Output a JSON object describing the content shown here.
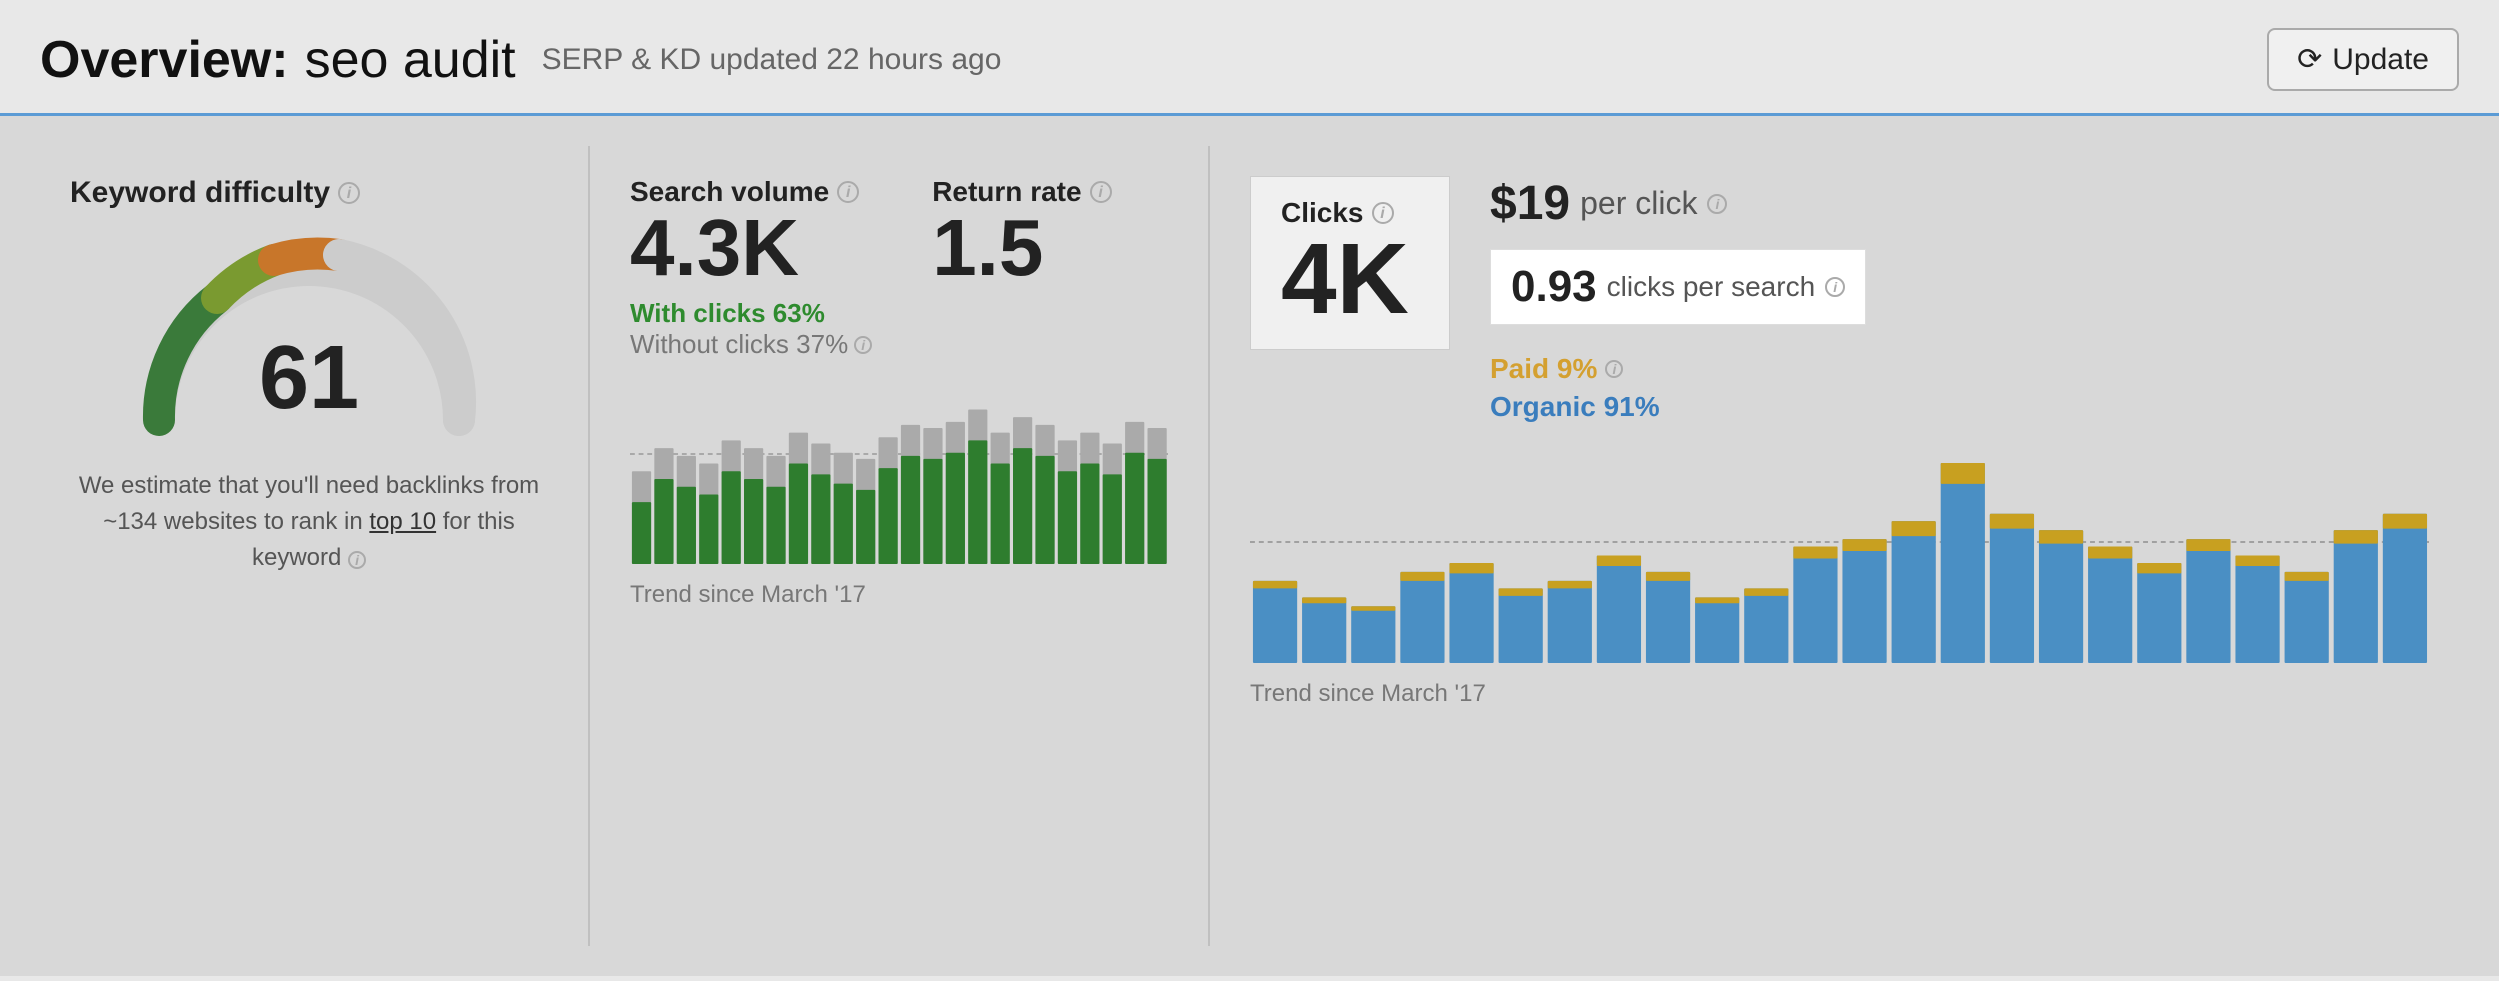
{
  "header": {
    "label": "Overview:",
    "project": "seo audit",
    "meta": "SERP & KD updated 22 hours ago",
    "update_label": "Update"
  },
  "keyword_difficulty": {
    "title": "Keyword difficulty",
    "value": "61",
    "desc": "We estimate that you'll need backlinks from ~134 websites to rank in",
    "link": "top 10",
    "desc2": "for this keyword"
  },
  "search_volume": {
    "title": "Search volume",
    "value": "4.3K",
    "return_rate_title": "Return rate",
    "return_rate_value": "1.5",
    "with_clicks": "With clicks 63%",
    "without_clicks": "Without clicks 37%",
    "trend_label": "Trend since March '17"
  },
  "clicks": {
    "title": "Clicks",
    "value": "4K",
    "per_click": "$19",
    "per_click_label": "per click",
    "cps_value": "0.93",
    "cps_label": "clicks per search",
    "paid": "Paid 9%",
    "organic": "Organic 91%",
    "trend_label": "Trend since March '17"
  },
  "info_icon_label": "i",
  "bar_data_sv": [
    40,
    55,
    50,
    45,
    60,
    55,
    50,
    65,
    58,
    52,
    48,
    62,
    70,
    68,
    72,
    80,
    65,
    75,
    70,
    60,
    65,
    58,
    72,
    68
  ],
  "bar_data_sv_max": [
    60,
    75,
    70,
    65,
    80,
    75,
    70,
    85,
    78,
    72,
    68,
    82,
    90,
    88,
    92,
    100,
    85,
    95,
    90,
    80,
    85,
    78,
    92,
    88
  ],
  "bar_data_clicks_organic": [
    50,
    40,
    35,
    55,
    60,
    45,
    50,
    65,
    55,
    40,
    45,
    70,
    75,
    85,
    120,
    90,
    80,
    70,
    60,
    75,
    65,
    55,
    80,
    90
  ],
  "bar_data_clicks_paid": [
    5,
    4,
    3,
    6,
    7,
    5,
    5,
    7,
    6,
    4,
    5,
    8,
    8,
    10,
    14,
    10,
    9,
    8,
    7,
    8,
    7,
    6,
    9,
    10
  ]
}
